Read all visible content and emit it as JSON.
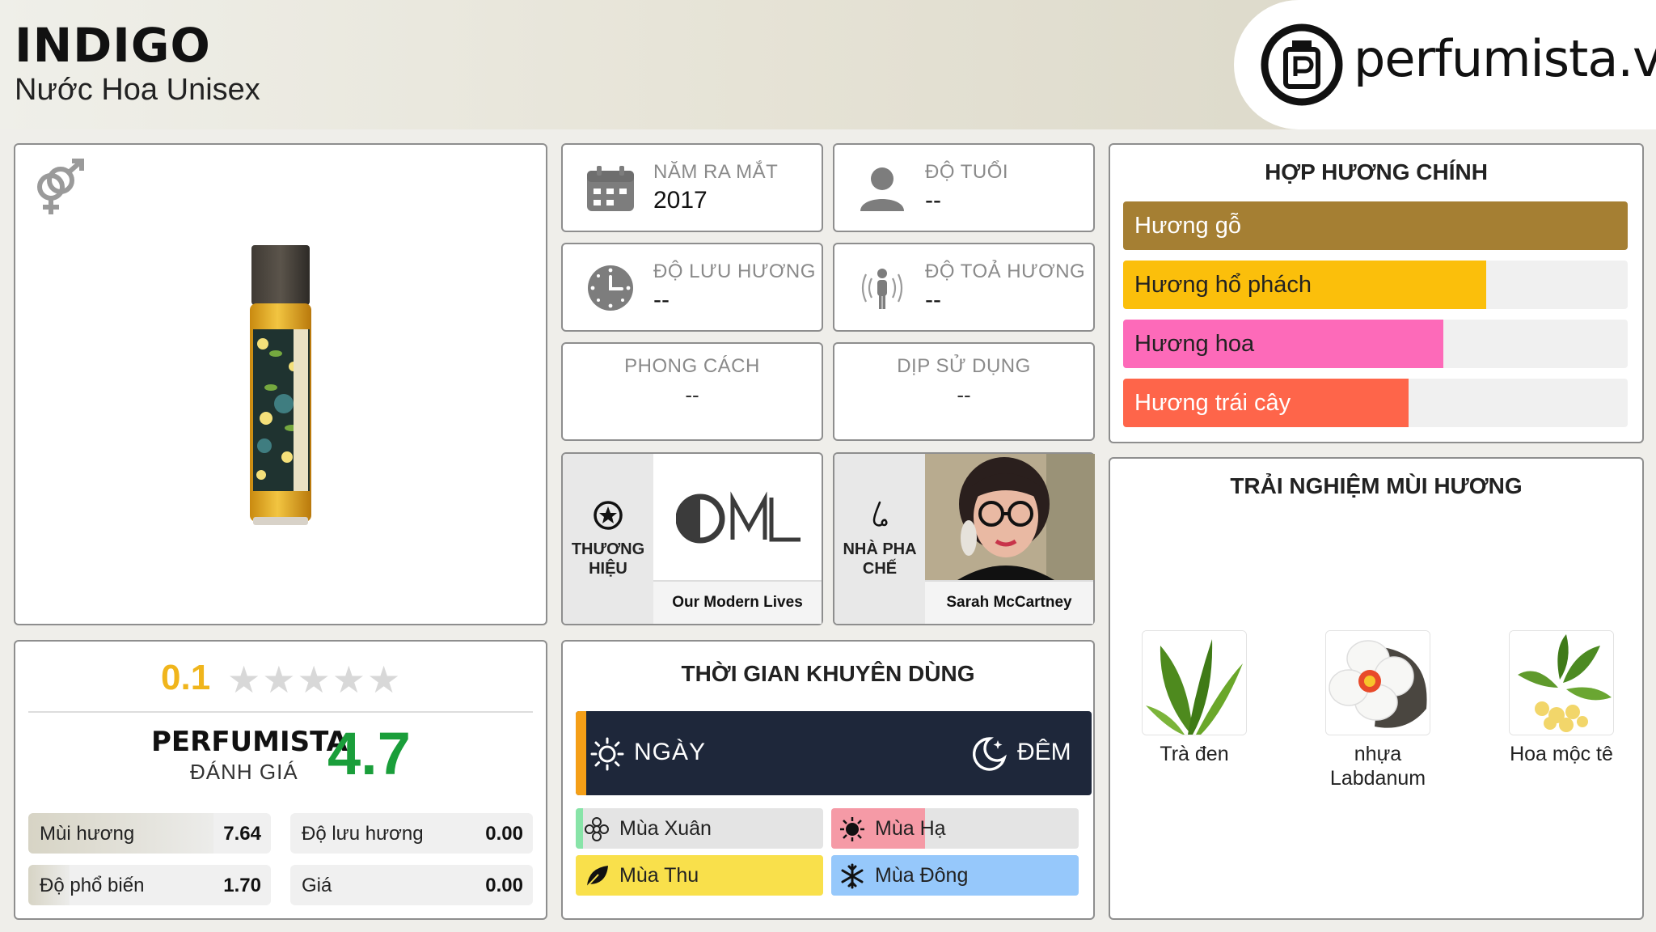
{
  "header": {
    "title": "INDIGO",
    "subtitle": "Nước Hoa Unisex",
    "logo_text": "perfumista.vn"
  },
  "info": {
    "launch_year": {
      "label": "NĂM RA MẮT",
      "value": "2017"
    },
    "age": {
      "label": "ĐỘ TUỔI",
      "value": "--"
    },
    "longevity": {
      "label": "ĐỘ LƯU HƯƠNG",
      "value": "--"
    },
    "sillage": {
      "label": "ĐỘ TOẢ HƯƠNG",
      "value": "--"
    },
    "style": {
      "label": "PHONG CÁCH",
      "value": "--"
    },
    "occasion": {
      "label": "DỊP SỬ DỤNG",
      "value": "--"
    }
  },
  "brand": {
    "label": "THƯƠNG HIỆU",
    "name": "Our Modern Lives"
  },
  "perfumer": {
    "label": "NHÀ PHA CHẾ",
    "name": "Sarah McCartney"
  },
  "notes": {
    "title": "HỢP HƯƠNG CHÍNH",
    "items": [
      {
        "label": "Hương gỗ",
        "level": 1.0,
        "color": "#a57f33"
      },
      {
        "label": "Hương hổ phách",
        "level": 0.72,
        "color": "#fbbf0b"
      },
      {
        "label": "Hương hoa",
        "level": 0.635,
        "color": "#fd6ab9"
      },
      {
        "label": "Hương trái cây",
        "level": 0.565,
        "color": "#fe654a"
      }
    ]
  },
  "rating": {
    "user_score": "0.1",
    "stars_filled": 0,
    "stars_total": 5,
    "perfumista_label": "PERFUMISTA",
    "perfumista_sub": "ĐÁNH GIÁ",
    "perfumista_score": "4.7",
    "metrics": [
      {
        "label": "Mùi hương",
        "value": "7.64",
        "level": 0.764
      },
      {
        "label": "Độ lưu hương",
        "value": "0.00",
        "level": 0
      },
      {
        "label": "Độ phổ biến",
        "value": "1.70",
        "level": 0.17
      },
      {
        "label": "Giá",
        "value": "0.00",
        "level": 0
      }
    ]
  },
  "time": {
    "title": "THỜI GIAN KHUYÊN DÙNG",
    "day_label": "NGÀY",
    "night_label": "ĐÊM",
    "day_level": 0.02,
    "seasons": [
      {
        "label": "Mùa Xuân",
        "level": 0.03,
        "color": "#88e4a8",
        "icon": "flower-icon"
      },
      {
        "label": "Mùa Hạ",
        "level": 0.38,
        "color": "#f59aa6",
        "icon": "sun-icon"
      },
      {
        "label": "Mùa Thu",
        "level": 1.0,
        "color": "#f9e04b",
        "icon": "leaf-icon"
      },
      {
        "label": "Mùa Đông",
        "level": 1.0,
        "color": "#96c8fb",
        "icon": "snowflake-icon"
      }
    ]
  },
  "experience": {
    "title": "TRẢI NGHIỆM MÙI HƯƠNG",
    "ingredients": [
      {
        "name": "Trà đen"
      },
      {
        "name": "nhựa Labdanum"
      },
      {
        "name": "Hoa mộc tê"
      }
    ]
  }
}
